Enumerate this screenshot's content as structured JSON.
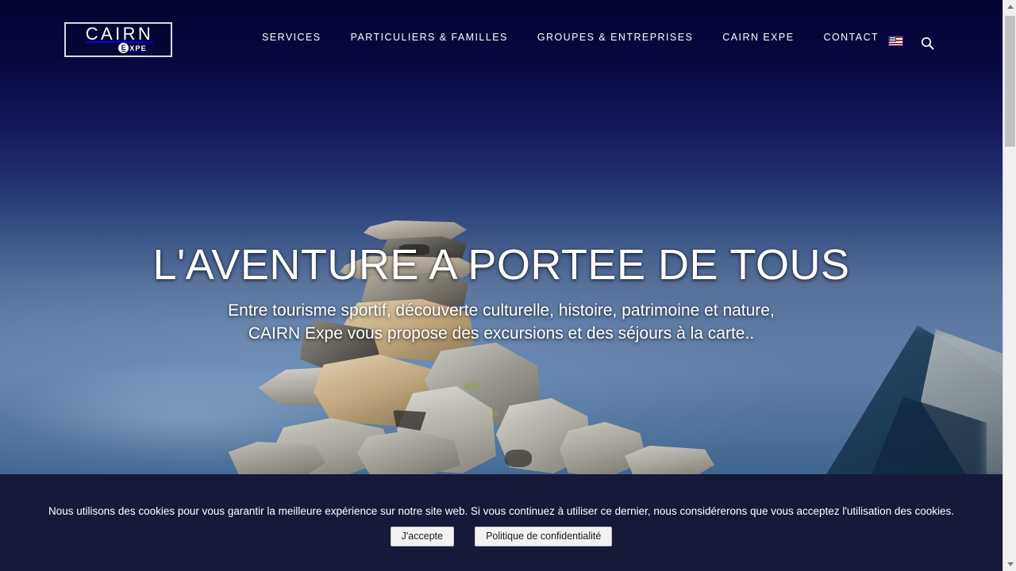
{
  "header": {
    "logo": {
      "word": "CAIRN",
      "badge_letter": "E",
      "badge_rest": "XPE"
    },
    "nav_items": [
      {
        "label": "SERVICES"
      },
      {
        "label": "PARTICULIERS & FAMILLES"
      },
      {
        "label": "GROUPES & ENTREPRISES"
      },
      {
        "label": "CAIRN EXPE"
      },
      {
        "label": "CONTACT"
      }
    ],
    "language_flag": "us-flag-icon",
    "search": "search-icon"
  },
  "hero": {
    "title": "L'AVENTURE A PORTEE DE TOUS",
    "subtitle_line1": "Entre tourisme sportif, découverte culturelle, histoire, patrimoine et nature,",
    "subtitle_line2": "CAIRN Expe vous propose des excursions et des séjours à la carte..",
    "image": "stone-cairn-mountain-photo"
  },
  "cookie_banner": {
    "message": "Nous utilisons des cookies pour vous garantir la meilleure expérience sur notre site web. Si vous continuez à utiliser ce dernier, nous considérerons que vous acceptez l'utilisation des cookies.",
    "accept_label": "J'accepte",
    "privacy_label": "Politique de confidentialité",
    "background_color": "#161a38"
  },
  "colors": {
    "sky_top": "#050531",
    "sky_bottom": "#4e7198",
    "banner": "#161a38",
    "text": "#ffffff"
  },
  "scrollbar": {
    "position": "right",
    "state": "near-top"
  }
}
